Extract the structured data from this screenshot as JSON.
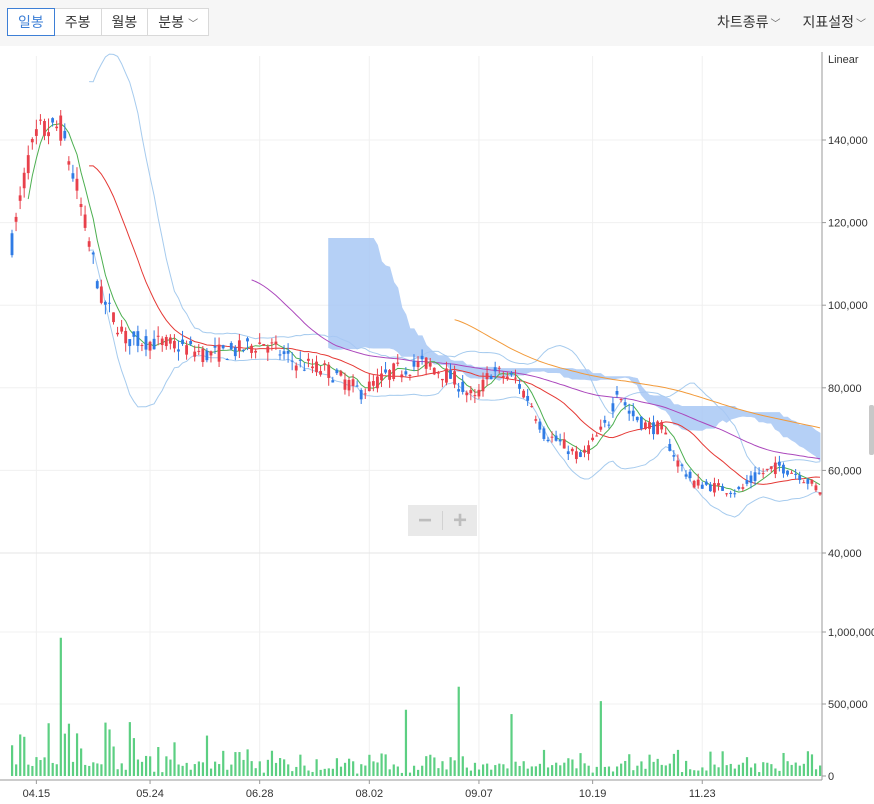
{
  "toolbar": {
    "tabs": [
      {
        "label": "일봉",
        "active": true
      },
      {
        "label": "주봉",
        "active": false
      },
      {
        "label": "월봉",
        "active": false
      },
      {
        "label": "분봉",
        "active": false,
        "dropdown": true
      }
    ],
    "right_menu": [
      {
        "label": "차트종류",
        "dropdown": true
      },
      {
        "label": "지표설정",
        "dropdown": true
      }
    ]
  },
  "colors": {
    "up": "#e8404b",
    "down": "#2f7be5",
    "volume": "#5ccf82",
    "ma_short": "#4caf50",
    "ma_mid": "#e53935",
    "ma_long": "#ab47bc",
    "ma_longest": "#f29a3a",
    "cloud": "#a9c8f5",
    "band": "#a6cbee"
  },
  "zoom": {
    "minus": "−",
    "plus": "+"
  },
  "chart_data": [
    {
      "type": "candlestick",
      "scale_label": "Linear",
      "x_tick_labels": [
        "04.15",
        "05.24",
        "06.28",
        "08.02",
        "09.07",
        "10.19",
        "11.23"
      ],
      "y_tick_labels": [
        "140,000",
        "120,000",
        "100,000",
        "80,000",
        "60,000",
        "40,000"
      ],
      "ylim": [
        40000,
        150000
      ],
      "trading_days": 200,
      "close_path": [
        [
          0,
          115000
        ],
        [
          4,
          135000
        ],
        [
          7,
          142000
        ],
        [
          12,
          143000
        ],
        [
          16,
          128000
        ],
        [
          22,
          102000
        ],
        [
          28,
          92000
        ],
        [
          35,
          91000
        ],
        [
          42,
          90000
        ],
        [
          48,
          88000
        ],
        [
          55,
          89000
        ],
        [
          62,
          91000
        ],
        [
          70,
          86000
        ],
        [
          78,
          84000
        ],
        [
          86,
          79000
        ],
        [
          94,
          84000
        ],
        [
          102,
          86000
        ],
        [
          109,
          82000
        ],
        [
          114,
          77000
        ],
        [
          118,
          84000
        ],
        [
          124,
          82000
        ],
        [
          128,
          76000
        ],
        [
          131,
          69000
        ],
        [
          136,
          66000
        ],
        [
          140,
          63000
        ],
        [
          144,
          68000
        ],
        [
          147,
          72000
        ],
        [
          149,
          80000
        ],
        [
          152,
          74000
        ],
        [
          156,
          71000
        ],
        [
          160,
          70000
        ],
        [
          164,
          62000
        ],
        [
          168,
          57000
        ],
        [
          173,
          56000
        ],
        [
          179,
          55000
        ],
        [
          184,
          59000
        ],
        [
          189,
          61000
        ],
        [
          194,
          59000
        ],
        [
          199,
          55000
        ]
      ]
    },
    {
      "type": "bar",
      "series_name": "volume",
      "y_tick_labels": [
        "1,000,000",
        "500,000",
        "0"
      ],
      "ylim": [
        0,
        1150000
      ],
      "peaks": [
        [
          12,
          960000
        ],
        [
          110,
          620000
        ],
        [
          145,
          520000
        ],
        [
          97,
          460000
        ],
        [
          123,
          430000
        ]
      ]
    }
  ]
}
